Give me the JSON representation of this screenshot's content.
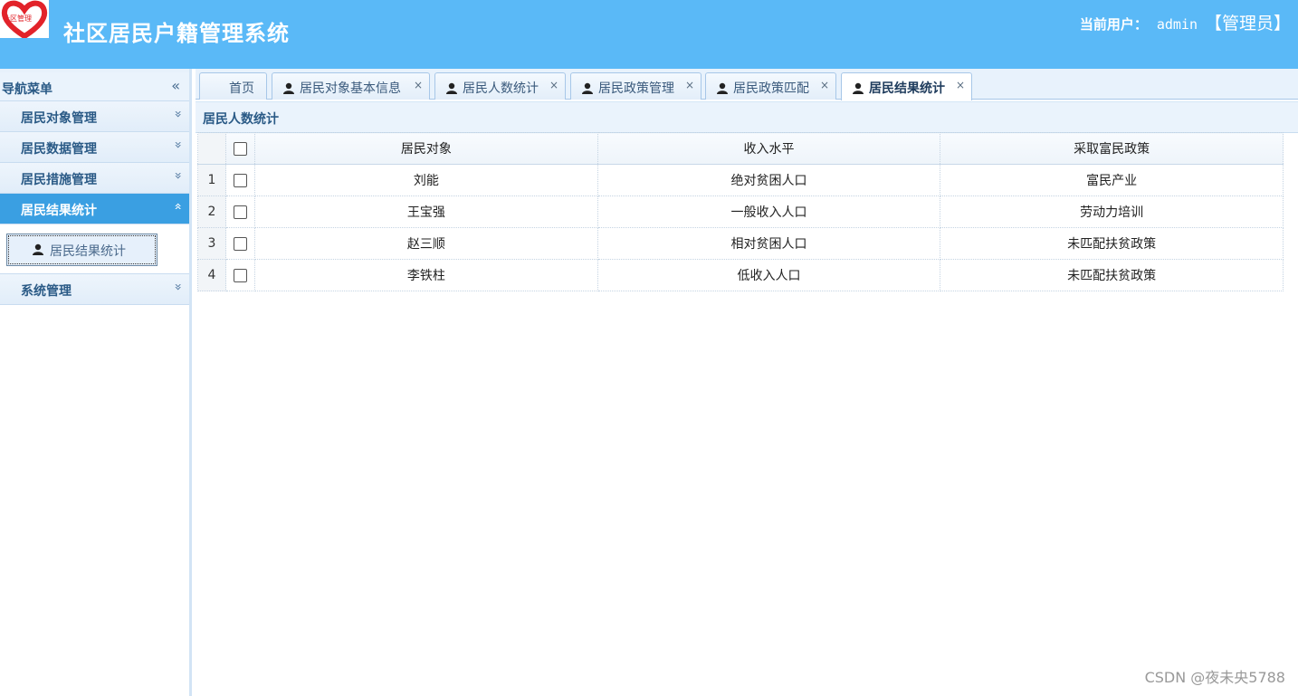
{
  "header": {
    "logo_text": "社区管理",
    "title": "社区居民户籍管理系统",
    "user_label": "当前用户：",
    "user_name": "admin",
    "user_role": "【管理员】"
  },
  "sidebar": {
    "title": "导航菜单",
    "collapse_glyph": "«",
    "items": [
      {
        "label": "居民对象管理",
        "glyph": "»"
      },
      {
        "label": "居民数据管理",
        "glyph": "»"
      },
      {
        "label": "居民措施管理",
        "glyph": "»"
      },
      {
        "label": "居民结果统计",
        "glyph": "«",
        "active": true
      },
      {
        "label": "系统管理",
        "glyph": "»"
      }
    ],
    "sub_items": [
      {
        "label": "居民结果统计",
        "icon": "user-icon"
      }
    ]
  },
  "tabs": [
    {
      "label": "首页",
      "closable": false
    },
    {
      "label": "居民对象基本信息",
      "icon": "user-icon",
      "closable": true
    },
    {
      "label": "居民人数统计",
      "icon": "user-icon",
      "closable": true
    },
    {
      "label": "居民政策管理",
      "icon": "user-icon",
      "closable": true
    },
    {
      "label": "居民政策匹配",
      "icon": "user-icon",
      "closable": true
    },
    {
      "label": "居民结果统计",
      "icon": "user-icon",
      "closable": true,
      "active": true
    }
  ],
  "tab_close_glyph": "×",
  "panel": {
    "title": "居民人数统计"
  },
  "table": {
    "columns": [
      "居民对象",
      "收入水平",
      "采取富民政策"
    ],
    "rows": [
      {
        "num": "1",
        "cells": [
          "刘能",
          "绝对贫困人口",
          "富民产业"
        ]
      },
      {
        "num": "2",
        "cells": [
          "王宝强",
          "一般收入人口",
          "劳动力培训"
        ]
      },
      {
        "num": "3",
        "cells": [
          "赵三顺",
          "相对贫困人口",
          "未匹配扶贫政策"
        ]
      },
      {
        "num": "4",
        "cells": [
          "李铁柱",
          "低收入人口",
          "未匹配扶贫政策"
        ]
      }
    ]
  },
  "watermark": "CSDN @夜未央5788",
  "colors": {
    "header_bg": "#5ab9f7",
    "nav_active_bg": "#3a9fe2",
    "logo_red": "#e2232a"
  }
}
